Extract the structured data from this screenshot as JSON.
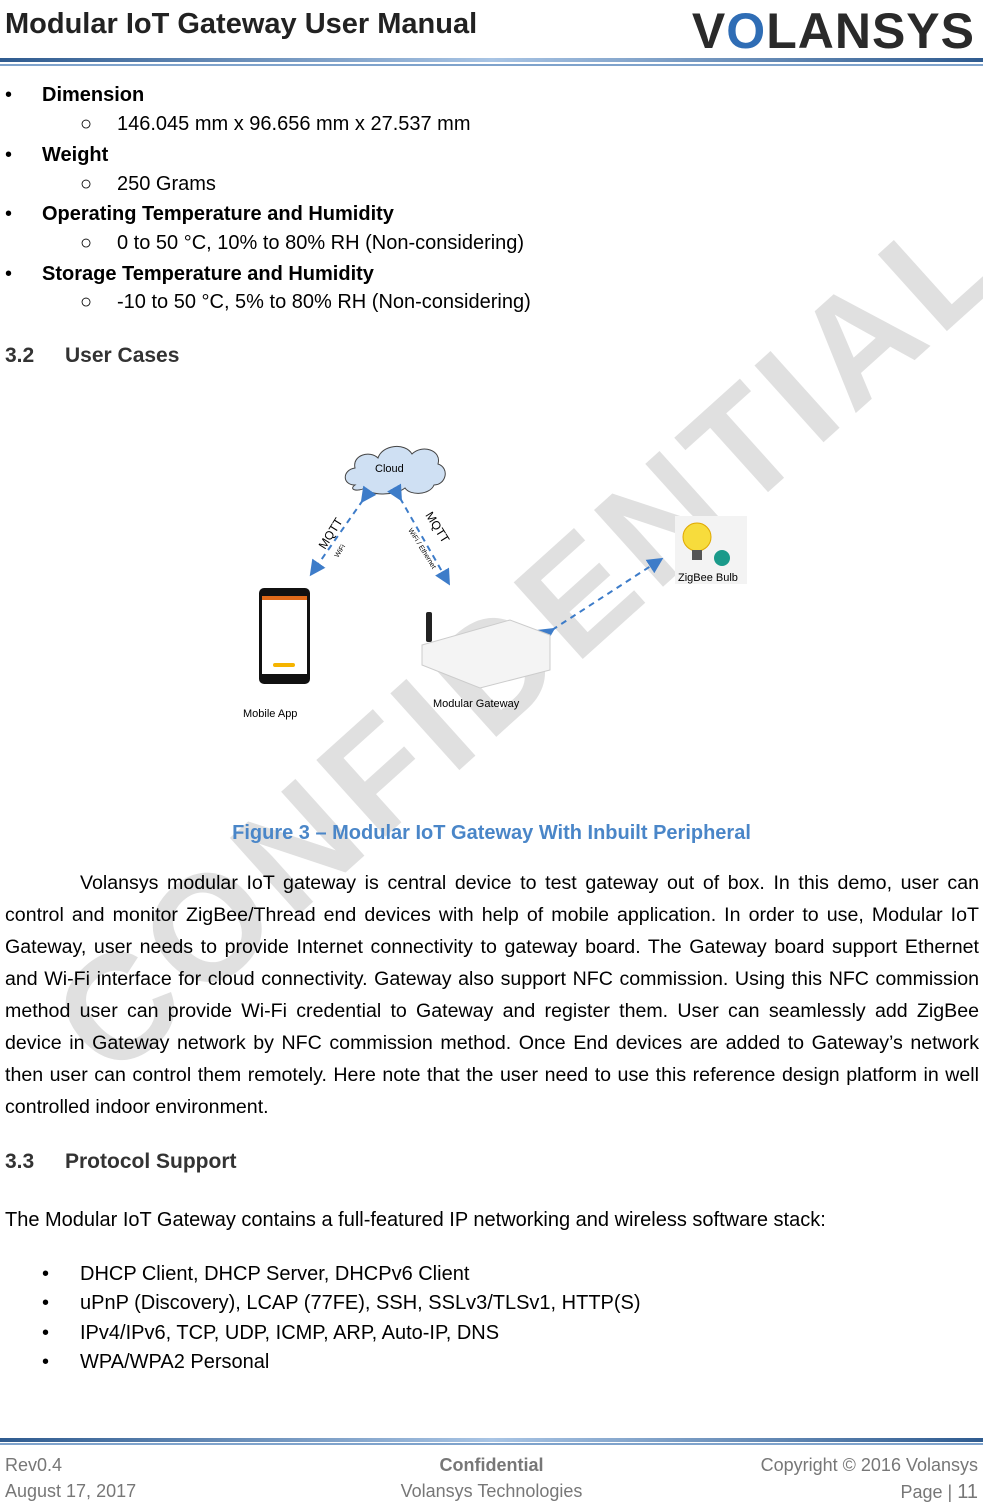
{
  "header": {
    "title": "Modular IoT Gateway User Manual",
    "logo": "VOLANSYS"
  },
  "specs": [
    {
      "label": "Dimension",
      "value": "146.045 mm x 96.656 mm x 27.537 mm"
    },
    {
      "label": "Weight",
      "value": "250 Grams"
    },
    {
      "label": "Operating Temperature and Humidity",
      "value": "0 to 50 °C, 10% to 80% RH (Non-considering)"
    },
    {
      "label": "Storage Temperature and Humidity",
      "value": "-10 to 50 °C, 5% to 80% RH (Non-considering)"
    }
  ],
  "section32": {
    "num": "3.2",
    "title": "User Cases"
  },
  "diagram": {
    "cloud": "Cloud",
    "mqtt": "MQTT",
    "wifi": "WiFi",
    "wifi_eth": "WiFi / Ethernet",
    "mobile": "Mobile App",
    "gateway": "Modular Gateway",
    "bulb": "ZigBee Bulb"
  },
  "figure_caption": "Figure 3 – Modular IoT Gateway With Inbuilt Peripheral",
  "paragraph": "Volansys modular IoT gateway is central device to test gateway out of box. In this demo, user can control and monitor ZigBee/Thread end devices with help of mobile application. In order to use, Modular IoT Gateway, user needs to provide Internet connectivity to gateway board. The Gateway board support Ethernet and Wi-Fi interface for cloud connectivity. Gateway also support NFC commission. Using this NFC commission method user can provide Wi-Fi credential to Gateway and register them. User can seamlessly add ZigBee device in Gateway network by NFC commission method. Once End devices are added to Gateway’s network then user can control them remotely. Here note that the user need to use this reference design platform in well controlled indoor environment.",
  "section33": {
    "num": "3.3",
    "title": "Protocol Support",
    "intro": "The Modular IoT Gateway contains a full-featured IP networking and wireless software stack:"
  },
  "protocols": [
    "DHCP Client, DHCP Server, DHCPv6 Client",
    "uPnP (Discovery), LCAP (77FE), SSH, SSLv3/TLSv1, HTTP(S)",
    "IPv4/IPv6, TCP, UDP, ICMP, ARP, Auto-IP, DNS",
    "WPA/WPA2 Personal"
  ],
  "watermark": "CONFIDENTIAL",
  "footer": {
    "rev": "Rev0.4",
    "date": "August 17, 2017",
    "confidential": "Confidential",
    "company": "Volansys Technologies",
    "copyright": "Copyright © 2016 Volansys",
    "page_label": "Page |",
    "page": "11"
  },
  "colors": {
    "accent": "#4a86c8",
    "arrow": "#3d7cc9"
  }
}
